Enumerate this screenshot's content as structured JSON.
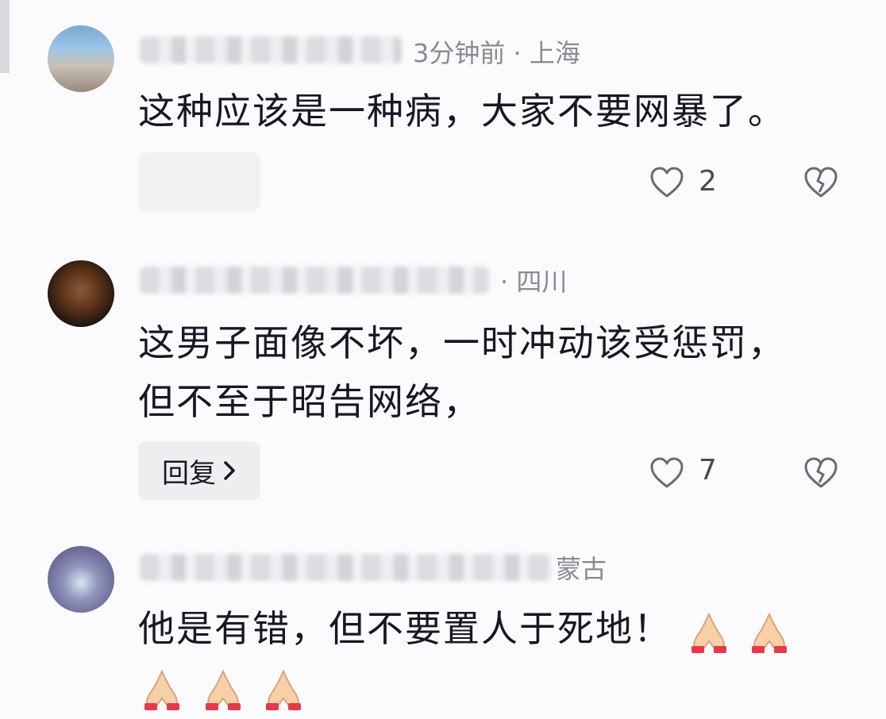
{
  "comments": [
    {
      "meta": "3分钟前 · 上海",
      "text_lines": [
        "这种应该是一种病，大家不要网暴了。"
      ],
      "likes": "2",
      "reply_label": ""
    },
    {
      "meta": "· 四川",
      "text_lines": [
        "这男子面像不坏，一时冲动该受惩罚，",
        "但不至于昭告网络，"
      ],
      "likes": "7",
      "reply_label": "回复"
    },
    {
      "meta": "蒙古",
      "text_lines": [
        "他是有错，但不要置人于死地！"
      ],
      "emoji_names": [
        "folded-hands-emoji",
        "folded-hands-emoji",
        "folded-hands-emoji",
        "folded-hands-emoji",
        "folded-hands-emoji"
      ]
    }
  ],
  "icons": {
    "like": "heart-outline-icon",
    "dislike": "broken-heart-icon",
    "reply_chevron": "chevron-right-icon"
  },
  "colors": {
    "text": "#161823",
    "meta": "#8a8b91",
    "reply_bg": "#eeeef1",
    "background": "#fbfbfd"
  }
}
